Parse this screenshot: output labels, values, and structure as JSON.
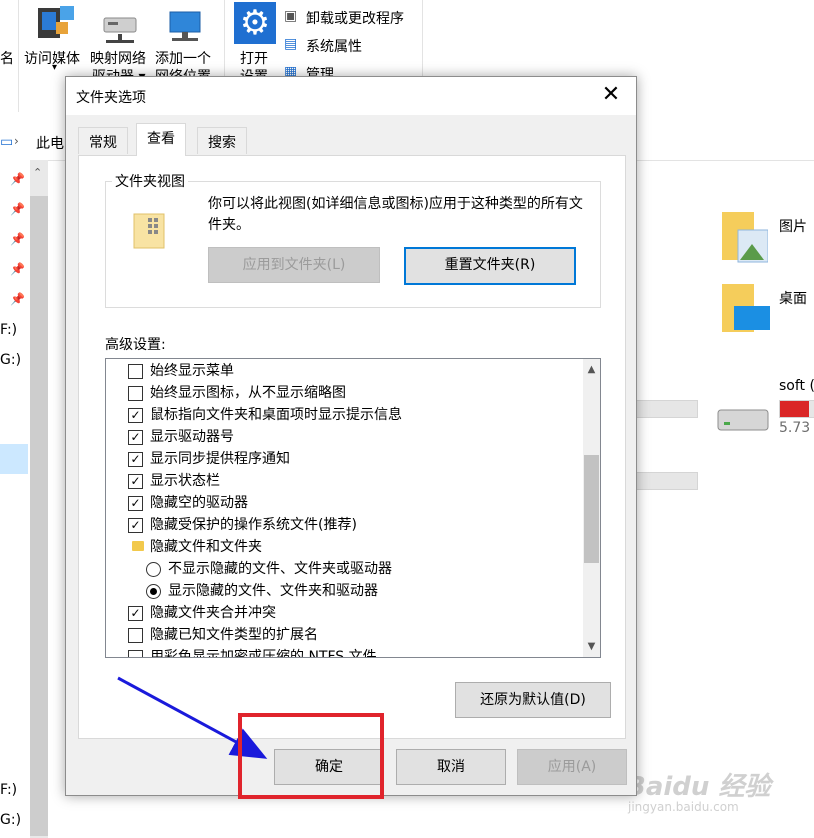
{
  "ribbon": {
    "items": [
      {
        "label_line1": "访问媒体",
        "label_line2": ""
      },
      {
        "label_line1": "映射网络",
        "label_line2": "驱动器 ▾"
      },
      {
        "label_line1": "添加一个",
        "label_line2": "网络位置"
      },
      {
        "label_line1": "打开",
        "label_line2": "设置"
      }
    ],
    "side_commands": [
      "卸载或更改程序",
      "系统属性",
      "管理"
    ],
    "left_cut_label": "名"
  },
  "address": {
    "path_text": "此电"
  },
  "nav": {
    "drives": [
      "F:)",
      "G:)",
      "F:)",
      "G:)"
    ]
  },
  "content": {
    "folders": [
      {
        "label": "图片"
      },
      {
        "label": "桌面"
      }
    ],
    "drive": {
      "name": "soft (",
      "size": "5.73",
      "used_fraction": 0.82
    }
  },
  "dialog": {
    "title": "文件夹选项",
    "close_glyph": "✕",
    "tabs": [
      "常规",
      "查看",
      "搜索"
    ],
    "active_tab": 1,
    "group": {
      "legend": "文件夹视图",
      "description": "你可以将此视图(如详细信息或图标)应用于这种类型的所有文件夹。",
      "apply_button": "应用到文件夹(L)",
      "reset_button": "重置文件夹(R)"
    },
    "advanced_label": "高级设置:",
    "settings": [
      {
        "type": "checkbox",
        "checked": false,
        "label": "始终显示菜单"
      },
      {
        "type": "checkbox",
        "checked": false,
        "label": "始终显示图标，从不显示缩略图"
      },
      {
        "type": "checkbox",
        "checked": true,
        "label": "鼠标指向文件夹和桌面项时显示提示信息"
      },
      {
        "type": "checkbox",
        "checked": true,
        "label": "显示驱动器号"
      },
      {
        "type": "checkbox",
        "checked": true,
        "label": "显示同步提供程序通知"
      },
      {
        "type": "checkbox",
        "checked": true,
        "label": "显示状态栏"
      },
      {
        "type": "checkbox",
        "checked": true,
        "label": "隐藏空的驱动器"
      },
      {
        "type": "checkbox",
        "checked": true,
        "label": "隐藏受保护的操作系统文件(推荐)"
      },
      {
        "type": "folder",
        "checked": false,
        "label": "隐藏文件和文件夹"
      },
      {
        "type": "radio",
        "checked": false,
        "label": "不显示隐藏的文件、文件夹或驱动器"
      },
      {
        "type": "radio",
        "checked": true,
        "label": "显示隐藏的文件、文件夹和驱动器"
      },
      {
        "type": "checkbox",
        "checked": true,
        "label": "隐藏文件夹合并冲突"
      },
      {
        "type": "checkbox",
        "checked": false,
        "label": "隐藏已知文件类型的扩展名"
      },
      {
        "type": "checkbox",
        "checked": false,
        "label": "用彩色显示加密或压缩的 NTFS 文件"
      }
    ],
    "restore_button": "还原为默认值(D)",
    "ok_button": "确定",
    "cancel_button": "取消",
    "apply_button": "应用(A)"
  },
  "watermark": {
    "text": "Baidu 经验",
    "sub": "jingyan.baidu.com"
  },
  "colors": {
    "accent": "#0078d7",
    "highlight_box": "#e0242c",
    "arrow": "#1a1adb",
    "drive_bar": "#da2626"
  }
}
